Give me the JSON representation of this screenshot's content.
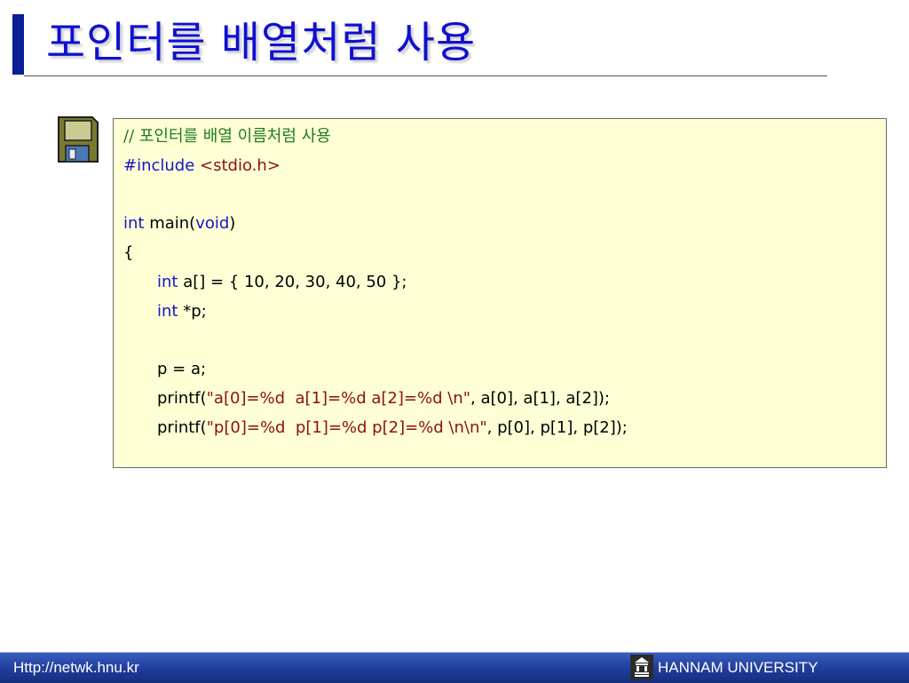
{
  "title": "포인터를 배열처럼 사용",
  "code": {
    "comment": "// 포인터를 배열 이름처럼 사용",
    "include_directive": "#include",
    "include_header": "<stdio.h>",
    "main_type": "int",
    "main_name": " main(",
    "main_param": "void",
    "main_close": ")",
    "open_brace": "{",
    "decl_a_type": "int",
    "decl_a_rest": " a[] = { 10, 20, 30, 40, 50 };",
    "decl_p_type": "int",
    "decl_p_rest": " *p;",
    "assign": "p = a;",
    "printf1_call": "printf(",
    "printf1_format": "\"a[0]=%d  a[1]=%d a[2]=%d \\n\"",
    "printf1_args": ", a[0], a[1], a[2]);",
    "printf2_call": "printf(",
    "printf2_format": "\"p[0]=%d  p[1]=%d p[2]=%d \\n\\n\"",
    "printf2_args": ", p[0], p[1], p[2]);"
  },
  "footer": {
    "url": "Http://netwk.hnu.kr",
    "university": "HANNAM  UNIVERSITY"
  },
  "icons": {
    "disk": "floppy-disk-icon",
    "logo": "university-logo-icon"
  },
  "colors": {
    "title": "#1010d0",
    "comment": "#1e7c20",
    "keyword": "#1414c8",
    "string": "#8c1010",
    "code_background": "#ffffd6",
    "footer": "#1c3a96"
  }
}
